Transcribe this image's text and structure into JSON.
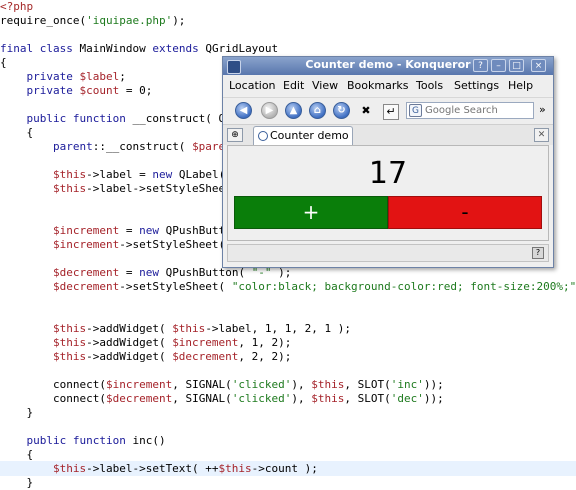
{
  "editor": {
    "lines": [
      {
        "parts": [
          {
            "t": "<?php",
            "c": "php"
          }
        ]
      },
      {
        "parts": [
          {
            "t": "require_once(",
            "c": "plain"
          },
          {
            "t": "'iquipae.php'",
            "c": "str"
          },
          {
            "t": ");",
            "c": "plain"
          }
        ]
      },
      {
        "parts": []
      },
      {
        "parts": [
          {
            "t": "final class ",
            "c": "kw"
          },
          {
            "t": "MainWindow ",
            "c": "plain"
          },
          {
            "t": "extends ",
            "c": "kw"
          },
          {
            "t": "QGridLayout",
            "c": "plain"
          }
        ]
      },
      {
        "parts": [
          {
            "t": "{",
            "c": "plain"
          }
        ]
      },
      {
        "parts": [
          {
            "t": "    private ",
            "c": "kw"
          },
          {
            "t": "$label",
            "c": "var"
          },
          {
            "t": ";",
            "c": "plain"
          }
        ]
      },
      {
        "parts": [
          {
            "t": "    private ",
            "c": "kw"
          },
          {
            "t": "$count",
            "c": "var"
          },
          {
            "t": " = 0;",
            "c": "plain"
          }
        ]
      },
      {
        "parts": []
      },
      {
        "parts": [
          {
            "t": "    public function ",
            "c": "kw"
          },
          {
            "t": "__construct( Q",
            "c": "plain"
          }
        ]
      },
      {
        "parts": [
          {
            "t": "    {",
            "c": "plain"
          }
        ]
      },
      {
        "parts": [
          {
            "t": "        parent",
            "c": "kw"
          },
          {
            "t": "::__construct( ",
            "c": "plain"
          },
          {
            "t": "$pare",
            "c": "var"
          }
        ]
      },
      {
        "parts": []
      },
      {
        "parts": [
          {
            "t": "        $this",
            "c": "var"
          },
          {
            "t": "->label = ",
            "c": "plain"
          },
          {
            "t": "new ",
            "c": "kw"
          },
          {
            "t": "QLabel(",
            "c": "plain"
          }
        ]
      },
      {
        "parts": [
          {
            "t": "        $this",
            "c": "var"
          },
          {
            "t": "->label->setStyleShee",
            "c": "plain"
          }
        ]
      },
      {
        "parts": []
      },
      {
        "parts": []
      },
      {
        "parts": [
          {
            "t": "        $increment",
            "c": "var"
          },
          {
            "t": " = ",
            "c": "plain"
          },
          {
            "t": "new ",
            "c": "kw"
          },
          {
            "t": "QPushButt",
            "c": "plain"
          }
        ]
      },
      {
        "parts": [
          {
            "t": "        $increment",
            "c": "var"
          },
          {
            "t": "->setStyleSheet(",
            "c": "plain"
          },
          {
            "t": "                                   00%;",
            "c": "str"
          }
        ]
      },
      {
        "parts": []
      },
      {
        "parts": [
          {
            "t": "        $decrement",
            "c": "var"
          },
          {
            "t": " = ",
            "c": "plain"
          },
          {
            "t": "new ",
            "c": "kw"
          },
          {
            "t": "QPushButton( ",
            "c": "plain"
          },
          {
            "t": "\"-\"",
            "c": "str"
          },
          {
            "t": " );",
            "c": "plain"
          }
        ]
      },
      {
        "parts": [
          {
            "t": "        $decrement",
            "c": "var"
          },
          {
            "t": "->setStyleSheet( ",
            "c": "plain"
          },
          {
            "t": "\"color:black; background-color:red; font-size:200%;\"",
            "c": "str"
          }
        ]
      },
      {
        "parts": []
      },
      {
        "parts": []
      },
      {
        "parts": [
          {
            "t": "        $this",
            "c": "var"
          },
          {
            "t": "->addWidget( ",
            "c": "plain"
          },
          {
            "t": "$this",
            "c": "var"
          },
          {
            "t": "->label, 1, 1, 2, 1 );",
            "c": "plain"
          }
        ]
      },
      {
        "parts": [
          {
            "t": "        $this",
            "c": "var"
          },
          {
            "t": "->addWidget( ",
            "c": "plain"
          },
          {
            "t": "$increment",
            "c": "var"
          },
          {
            "t": ", 1, 2);",
            "c": "plain"
          }
        ]
      },
      {
        "parts": [
          {
            "t": "        $this",
            "c": "var"
          },
          {
            "t": "->addWidget( ",
            "c": "plain"
          },
          {
            "t": "$decrement",
            "c": "var"
          },
          {
            "t": ", 2, 2);",
            "c": "plain"
          }
        ]
      },
      {
        "parts": []
      },
      {
        "parts": [
          {
            "t": "        connect(",
            "c": "plain"
          },
          {
            "t": "$increment",
            "c": "var"
          },
          {
            "t": ", SIGNAL(",
            "c": "plain"
          },
          {
            "t": "'clicked'",
            "c": "str"
          },
          {
            "t": "), ",
            "c": "plain"
          },
          {
            "t": "$this",
            "c": "var"
          },
          {
            "t": ", SLOT(",
            "c": "plain"
          },
          {
            "t": "'inc'",
            "c": "str"
          },
          {
            "t": "));",
            "c": "plain"
          }
        ]
      },
      {
        "parts": [
          {
            "t": "        connect(",
            "c": "plain"
          },
          {
            "t": "$decrement",
            "c": "var"
          },
          {
            "t": ", SIGNAL(",
            "c": "plain"
          },
          {
            "t": "'clicked'",
            "c": "str"
          },
          {
            "t": "), ",
            "c": "plain"
          },
          {
            "t": "$this",
            "c": "var"
          },
          {
            "t": ", SLOT(",
            "c": "plain"
          },
          {
            "t": "'dec'",
            "c": "str"
          },
          {
            "t": "));",
            "c": "plain"
          }
        ]
      },
      {
        "parts": [
          {
            "t": "    }",
            "c": "plain"
          }
        ]
      },
      {
        "parts": []
      },
      {
        "parts": [
          {
            "t": "    public function ",
            "c": "kw"
          },
          {
            "t": "inc()",
            "c": "plain"
          }
        ]
      },
      {
        "parts": [
          {
            "t": "    {",
            "c": "plain"
          }
        ]
      },
      {
        "parts": [
          {
            "t": "        $this",
            "c": "var"
          },
          {
            "t": "->label->setText( ++",
            "c": "plain"
          },
          {
            "t": "$this",
            "c": "var"
          },
          {
            "t": "->count );",
            "c": "plain"
          }
        ]
      },
      {
        "parts": [
          {
            "t": "    }",
            "c": "plain"
          }
        ]
      }
    ],
    "highlighted_line": 33
  },
  "window": {
    "title": "Counter demo - Konqueror",
    "buttons": {
      "help": "?",
      "minimize": "–",
      "maximize": "□",
      "close": "×"
    },
    "menus": [
      "Location",
      "Edit",
      "View",
      "Bookmarks",
      "Tools",
      "Settings",
      "Help"
    ],
    "search_placeholder": "Google Search",
    "search_engine_glyph": "G",
    "more_glyph": "»",
    "tab_label": "Counter demo",
    "new_tab_glyph": "⊕",
    "close_tab_glyph": "✕",
    "status_text": "",
    "app": {
      "counter": "17",
      "increment_label": "+",
      "decrement_label": "-"
    }
  },
  "colors": {
    "increment_bg": "#0a7e0a",
    "decrement_bg": "#e21313",
    "titlebar": "#5876ad",
    "keyword": "#1b1b9a",
    "variable": "#a5232a",
    "string": "#1e7a1e"
  }
}
